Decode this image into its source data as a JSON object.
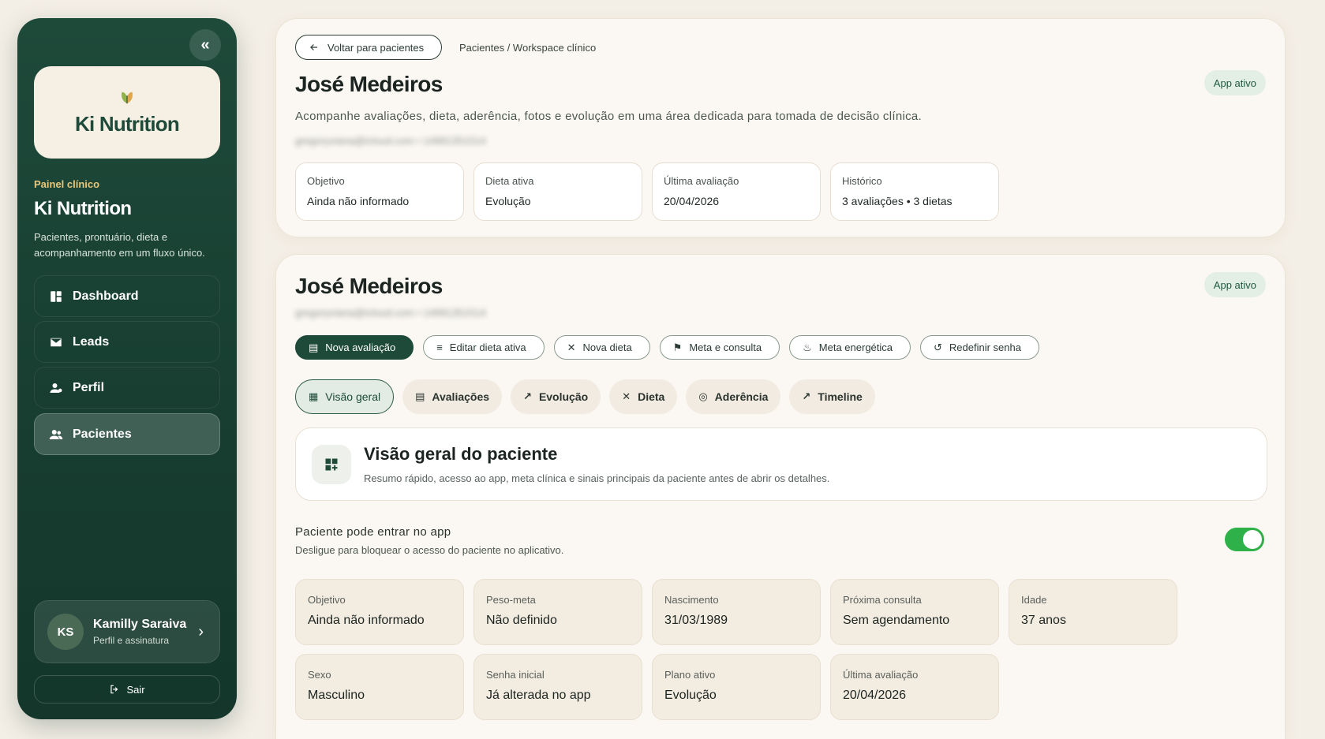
{
  "sidebar": {
    "logo_text": "Ki Nutrition",
    "kicker": "Painel clínico",
    "title": "Ki Nutrition",
    "description": "Pacientes, prontuário, dieta e acompanhamento em um fluxo único.",
    "nav": [
      {
        "label": "Dashboard",
        "icon": "dashboard-icon"
      },
      {
        "label": "Leads",
        "icon": "mail-icon"
      },
      {
        "label": "Perfil",
        "icon": "profile-icon"
      },
      {
        "label": "Pacientes",
        "icon": "patients-icon",
        "active": true
      }
    ],
    "user": {
      "initials": "KS",
      "name": "Kamilly Saraiva",
      "subtitle": "Perfil e assinatura"
    },
    "logout": "Sair"
  },
  "header": {
    "back_label": "Voltar para pacientes",
    "breadcrumb": "Pacientes / Workspace clínico",
    "patient_name": "José Medeiros",
    "subtitle": "Acompanhe avaliações, dieta, aderência, fotos e evolução em uma área dedicada para tomada de decisão clínica.",
    "contact_blurred": "gregoryviana@icloud.com  •  14991351514",
    "status_badge": "App ativo",
    "stats": [
      {
        "label": "Objetivo",
        "value": "Ainda não informado"
      },
      {
        "label": "Dieta ativa",
        "value": "Evolução"
      },
      {
        "label": "Última avaliação",
        "value": "20/04/2026"
      },
      {
        "label": "Histórico",
        "value": "3 avaliações • 3 dietas"
      }
    ]
  },
  "patient": {
    "name": "José Medeiros",
    "contact_blurred": "gregoryviana@icloud.com  •  14991351514",
    "status_badge": "App ativo",
    "actions": [
      {
        "label": "Nova avaliação",
        "icon": "clipboard-icon",
        "primary": true
      },
      {
        "label": "Editar dieta ativa",
        "icon": "edit-list-icon"
      },
      {
        "label": "Nova dieta",
        "icon": "utensils-icon"
      },
      {
        "label": "Meta e consulta",
        "icon": "flag-icon"
      },
      {
        "label": "Meta energética",
        "icon": "flame-icon"
      },
      {
        "label": "Redefinir senha",
        "icon": "reset-icon"
      }
    ],
    "tabs": [
      {
        "label": "Visão geral",
        "icon": "grid-icon",
        "active": true
      },
      {
        "label": "Avaliações",
        "icon": "clipboard-icon"
      },
      {
        "label": "Evolução",
        "icon": "trend-icon"
      },
      {
        "label": "Dieta",
        "icon": "utensils-icon"
      },
      {
        "label": "Aderência",
        "icon": "target-icon"
      },
      {
        "label": "Timeline",
        "icon": "trend-icon"
      }
    ],
    "overview": {
      "title": "Visão geral do paciente",
      "description": "Resumo rápido, acesso ao app, meta clínica e sinais principais da paciente antes de abrir os detalhes."
    },
    "app_access": {
      "title": "Paciente pode entrar no app",
      "description": "Desligue para bloquear o acesso do paciente no aplicativo.",
      "enabled": true
    },
    "info": [
      {
        "label": "Objetivo",
        "value": "Ainda não informado"
      },
      {
        "label": "Peso-meta",
        "value": "Não definido"
      },
      {
        "label": "Nascimento",
        "value": "31/03/1989"
      },
      {
        "label": "Próxima consulta",
        "value": "Sem agendamento"
      },
      {
        "label": "Idade",
        "value": "37 anos"
      },
      {
        "label": "Sexo",
        "value": "Masculino"
      },
      {
        "label": "Senha inicial",
        "value": "Já alterada no app"
      },
      {
        "label": "Plano ativo",
        "value": "Evolução"
      },
      {
        "label": "Última avaliação",
        "value": "20/04/2026"
      }
    ]
  },
  "colors": {
    "brand": "#1e4a3a",
    "toggle_on": "#2fb14a",
    "accent": "#e9c77a"
  }
}
